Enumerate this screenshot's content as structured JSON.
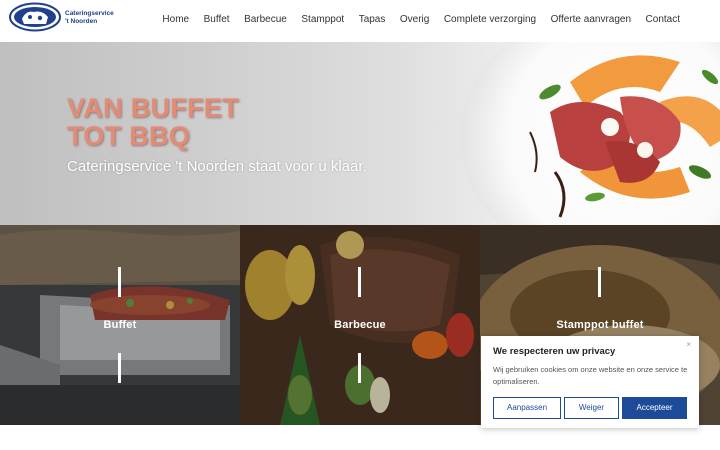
{
  "brand": {
    "line1": "Cateringservice",
    "line2": "'t Noorden",
    "logo_icon": "cow-logo-icon",
    "color": "#1f3f8f"
  },
  "nav": {
    "items": [
      {
        "label": "Home"
      },
      {
        "label": "Buffet"
      },
      {
        "label": "Barbecue"
      },
      {
        "label": "Stamppot"
      },
      {
        "label": "Tapas"
      },
      {
        "label": "Overig"
      },
      {
        "label": "Complete verzorging"
      },
      {
        "label": "Offerte aanvragen"
      },
      {
        "label": "Contact"
      }
    ]
  },
  "hero": {
    "title_line1": "VAN BUFFET",
    "title_line2": "TOT BBQ",
    "subtitle": "Cateringservice 't Noorden staat voor u klaar.",
    "accent": "#e38c75"
  },
  "tiles": [
    {
      "label": "Buffet"
    },
    {
      "label": "Barbecue"
    },
    {
      "label": "Stamppot buffet"
    }
  ],
  "cookie": {
    "title": "We respecteren uw privacy",
    "close": "×",
    "text": "Wij gebruiken cookies om onze website en onze service te optimaliseren.",
    "customize": "Aanpassen",
    "decline": "Weiger",
    "accept": "Accepteer",
    "accent": "#1e4a9a"
  }
}
